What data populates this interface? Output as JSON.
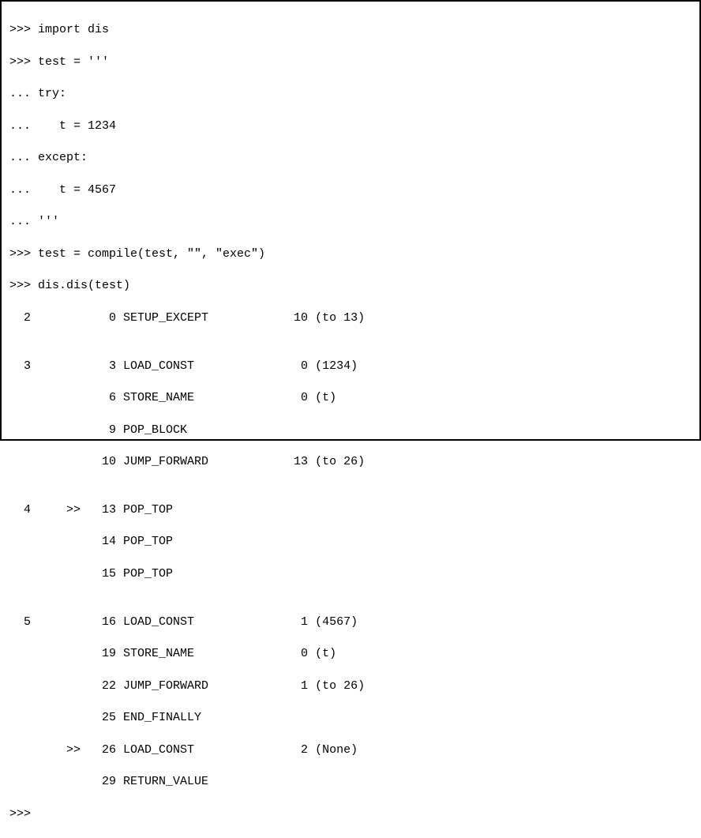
{
  "terminal": {
    "lines": [
      ">>> import dis",
      ">>> test = '''",
      "... try:",
      "...    t = 1234",
      "... except:",
      "...    t = 4567",
      "... '''",
      ">>> test = compile(test, \"\", \"exec\")",
      ">>> dis.dis(test)",
      "  2           0 SETUP_EXCEPT            10 (to 13)",
      "",
      "  3           3 LOAD_CONST               0 (1234)",
      "              6 STORE_NAME               0 (t)",
      "              9 POP_BLOCK",
      "             10 JUMP_FORWARD            13 (to 26)",
      "",
      "  4     >>   13 POP_TOP",
      "             14 POP_TOP",
      "             15 POP_TOP",
      "",
      "  5          16 LOAD_CONST               1 (4567)",
      "             19 STORE_NAME               0 (t)",
      "             22 JUMP_FORWARD             1 (to 26)",
      "             25 END_FINALLY",
      "        >>   26 LOAD_CONST               2 (None)",
      "             29 RETURN_VALUE",
      ">>>"
    ]
  }
}
